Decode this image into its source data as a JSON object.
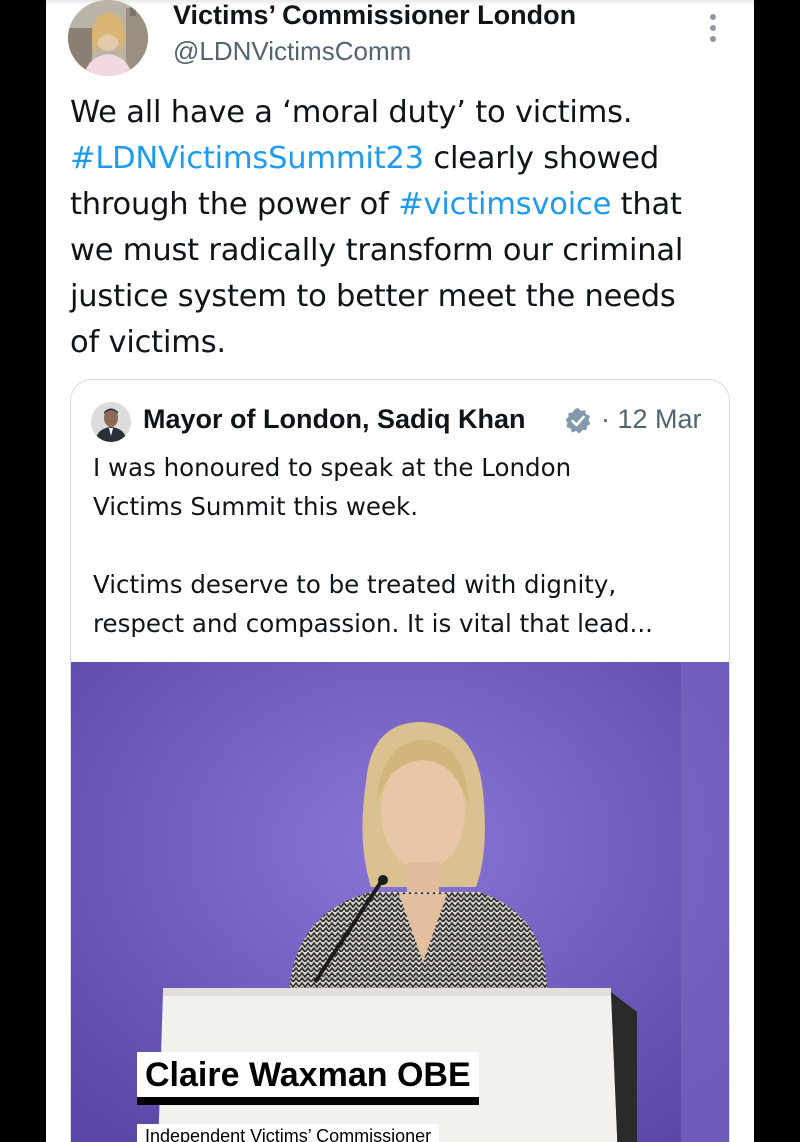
{
  "tweet": {
    "author_name": "Victims’ Commissioner London",
    "author_handle": "@LDNVictimsComm",
    "more_icon": "more-vertical-icon",
    "text_lines": {
      "l1": "We all have a ‘moral duty’ to victims.",
      "l2_tag": "#LDNVictimsSummit23",
      "l2_rest": " clearly showed",
      "l3_pre": "through the power of ",
      "l3_tag": "#victimsvoice",
      "l3_post": " that",
      "l4": "we must radically transform our criminal",
      "l5": "justice system to better meet the needs",
      "l6": "of victims."
    },
    "colors": {
      "hashtag": "#1d9bf0",
      "text": "#0f1419",
      "secondary": "#536471",
      "media_background": "#6a54b8"
    }
  },
  "quoted_tweet": {
    "author_name": "Mayor of London, Sadiq Khan",
    "verified_icon": "verified-badge-icon",
    "date": "· 12 Mar",
    "text_lines": {
      "l1": "I was honoured to speak at the London",
      "l2": "Victims Summit this week.",
      "l3": "",
      "l4": "Victims deserve to be treated with dignity,",
      "l5": "respect and compassion. It is vital that lead..."
    },
    "media": {
      "caption_name": "Claire Waxman OBE",
      "caption_role": "Independent Victims’ Commissioner"
    }
  }
}
